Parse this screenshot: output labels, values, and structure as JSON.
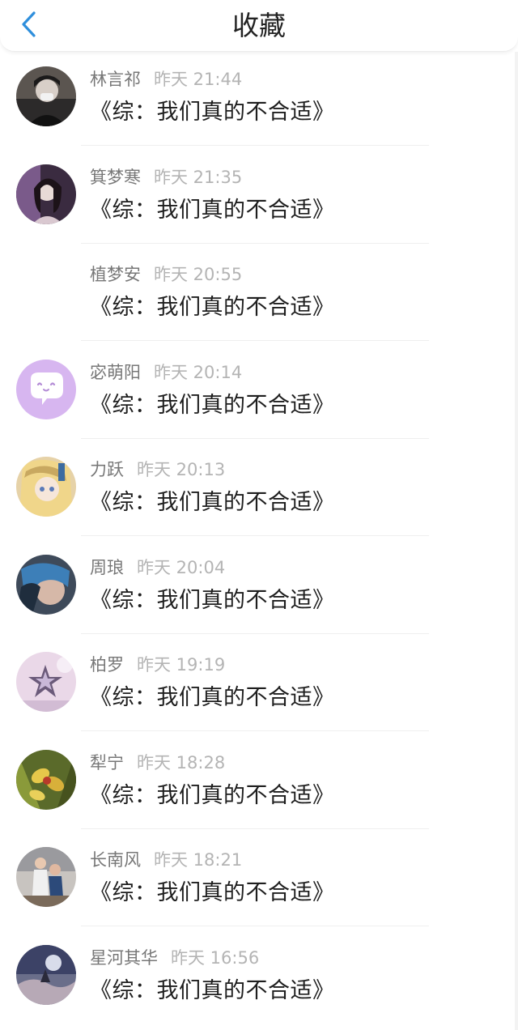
{
  "header": {
    "title": "收藏"
  },
  "colors": {
    "accent": "#2f8fdc"
  },
  "items": [
    {
      "name": "林言祁",
      "time": "昨天 21:44",
      "message": "《综：我们真的不合适》",
      "avatar": "photo-avatar-dark"
    },
    {
      "name": "箕梦寒",
      "time": "昨天 21:35",
      "message": "《综：我们真的不合适》",
      "avatar": "photo-avatar-purple"
    },
    {
      "name": "植梦安",
      "time": "昨天 20:55",
      "message": "《综：我们真的不合适》",
      "avatar": "none"
    },
    {
      "name": "宓萌阳",
      "time": "昨天 20:14",
      "message": "《综：我们真的不合适》",
      "avatar": "chat-bubble-icon"
    },
    {
      "name": "力跃",
      "time": "昨天 20:13",
      "message": "《综：我们真的不合适》",
      "avatar": "photo-avatar-anime"
    },
    {
      "name": "周琅",
      "time": "昨天 20:04",
      "message": "《综：我们真的不合适》",
      "avatar": "photo-avatar-blue"
    },
    {
      "name": "柏罗",
      "time": "昨天 19:19",
      "message": "《综：我们真的不合适》",
      "avatar": "photo-avatar-star"
    },
    {
      "name": "犁宁",
      "time": "昨天 18:28",
      "message": "《综：我们真的不合适》",
      "avatar": "photo-avatar-flower"
    },
    {
      "name": "长南风",
      "time": "昨天 18:21",
      "message": "《综：我们真的不合适》",
      "avatar": "photo-avatar-couple"
    },
    {
      "name": "星河其华",
      "time": "昨天 16:56",
      "message": "《综：我们真的不合适》",
      "avatar": "photo-avatar-sky"
    }
  ]
}
